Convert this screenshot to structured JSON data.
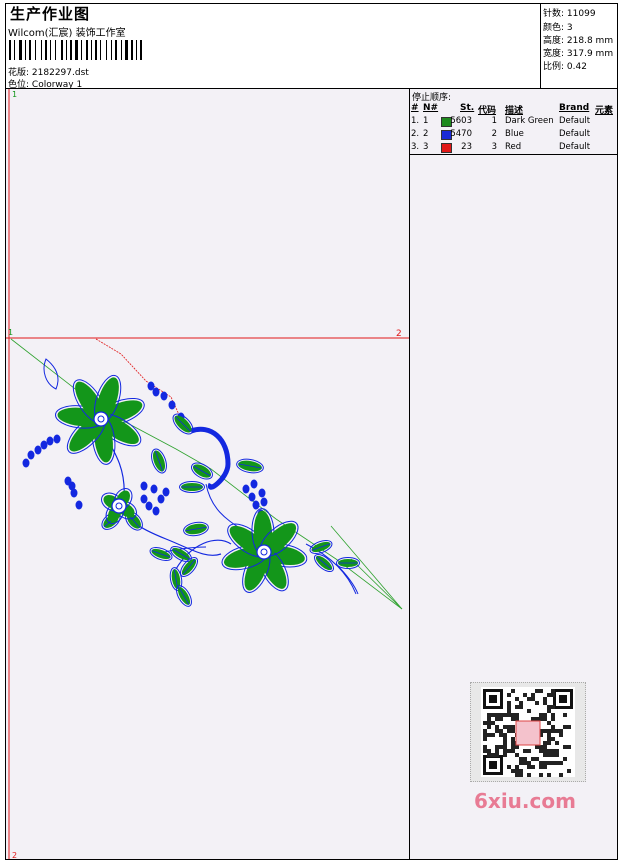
{
  "header": {
    "title": "生产作业图",
    "studio": "Wilcom(汇宸) 装饰工作室",
    "file_label": "花版:",
    "file_value": "2182297.dst",
    "colorway_label": "色位:",
    "colorway_value": "Colorway 1"
  },
  "stats": [
    {
      "label": "针数:",
      "value": "11099"
    },
    {
      "label": "颜色:",
      "value": "3"
    },
    {
      "label": "高度:",
      "value": "218.8 mm"
    },
    {
      "label": "宽度:",
      "value": "317.9 mm"
    },
    {
      "label": "比例:",
      "value": "0.42"
    }
  ],
  "stop_sequence": {
    "title": "停止顺序:",
    "columns": [
      "#",
      "N#",
      "St.",
      "代码",
      "描述",
      "Brand",
      "元素"
    ],
    "rows": [
      {
        "idx": "1.",
        "n": "1",
        "swatch": "#1e8a1e",
        "stitches": "5603",
        "code": "1",
        "desc": "Dark Green",
        "brand": "Default"
      },
      {
        "idx": "2.",
        "n": "2",
        "swatch": "#1a2ad6",
        "stitches": "5470",
        "code": "2",
        "desc": "Blue",
        "brand": "Default"
      },
      {
        "idx": "3.",
        "n": "3",
        "swatch": "#e01818",
        "stitches": "23",
        "code": "3",
        "desc": "Red",
        "brand": "Default"
      }
    ]
  },
  "canvas_markers": {
    "top_left": "1",
    "mid_left": "1",
    "mid_right": "2",
    "bottom_left": "2"
  },
  "colors": {
    "green": "#13961a",
    "blue": "#1328e0",
    "red": "#e01818",
    "guide_green": "#2fa22f"
  },
  "watermark": "6xiu.com"
}
